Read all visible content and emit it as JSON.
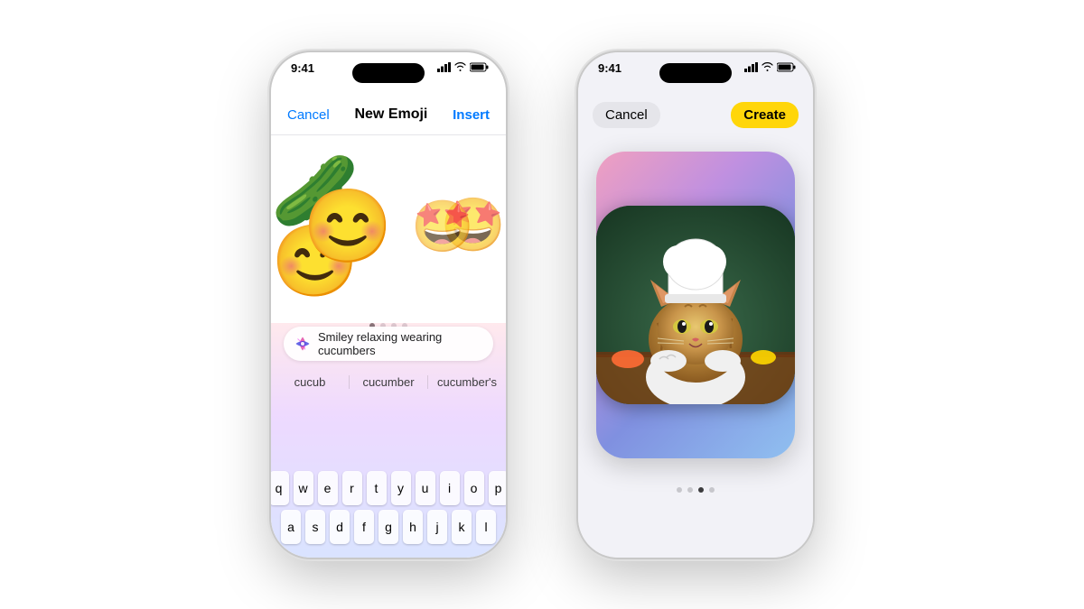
{
  "phone1": {
    "statusTime": "9:41",
    "navCancel": "Cancel",
    "navTitle": "New Emoji",
    "navInsert": "Insert",
    "emojiLarge": "🥒",
    "emojiSmall": "😄",
    "searchText": "Smiley relaxing wearing cucumbers",
    "autocomplete": [
      "cucub",
      "cucumber",
      "cucumber's"
    ],
    "keyRow1": [
      "q",
      "w",
      "e",
      "r",
      "t",
      "y",
      "u",
      "i",
      "o",
      "p"
    ],
    "keyRow2": [
      "a",
      "s",
      "d",
      "f",
      "g",
      "h",
      "j",
      "k",
      "l"
    ],
    "dots": [
      true,
      false,
      false,
      false
    ]
  },
  "phone2": {
    "statusTime": "9:41",
    "btnCancel": "Cancel",
    "btnCreate": "Create",
    "dots": [
      false,
      false,
      true,
      false
    ]
  }
}
